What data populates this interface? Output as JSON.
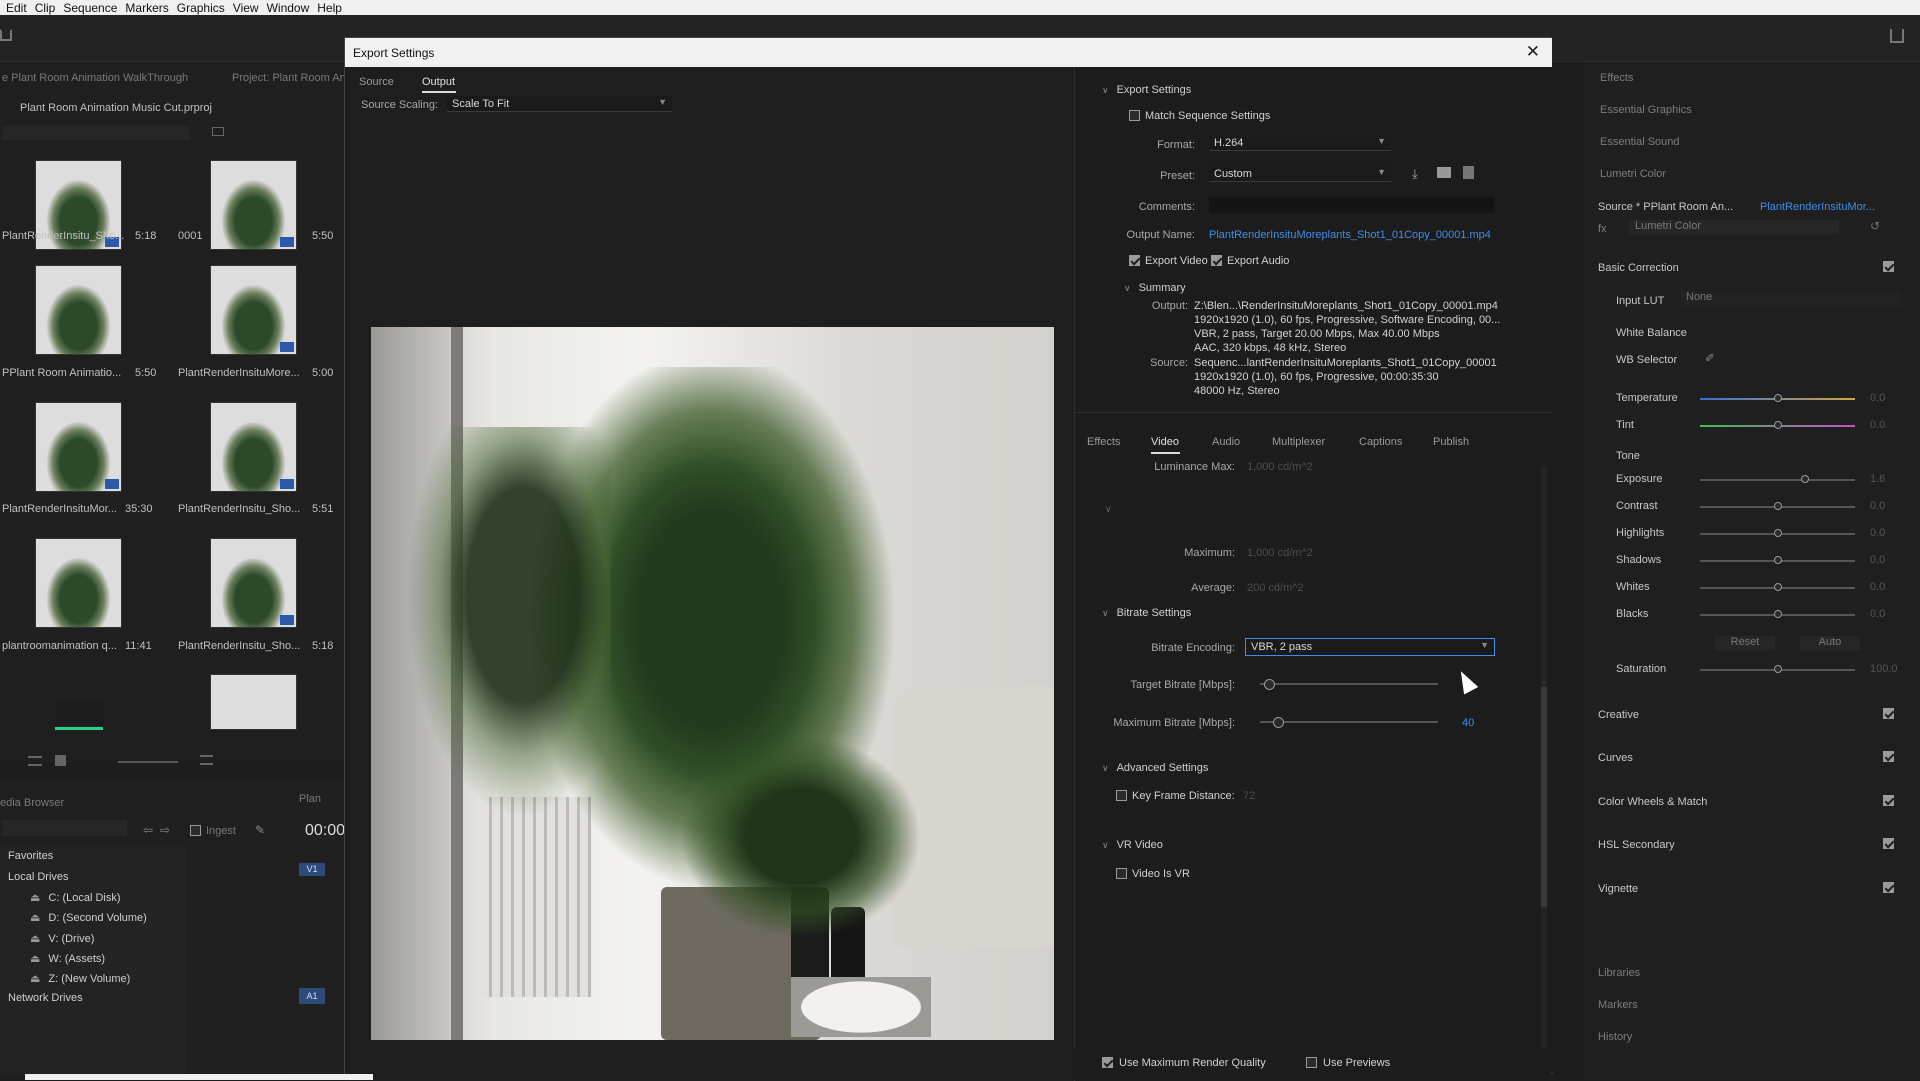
{
  "menubar": {
    "items": [
      "Edit",
      "Clip",
      "Sequence",
      "Markers",
      "Graphics",
      "View",
      "Window",
      "Help"
    ]
  },
  "project": {
    "tab_left": "e Plant Room Animation WalkThrough",
    "tab_right": "Project: Plant Room An",
    "file": "Plant Room Animation Music Cut.prproj",
    "items": [
      {
        "name": "PlantRenderInsitu_Sho...",
        "dur": "5:18"
      },
      {
        "name": "0001",
        "dur": "5:50"
      },
      {
        "name": "PPlant Room Animatio...",
        "dur": "5:50"
      },
      {
        "name": "PlantRenderInsituMore...",
        "dur": "5:00"
      },
      {
        "name": "PlantRenderInsituMor...",
        "dur": "35:30"
      },
      {
        "name": "PlantRenderInsitu_Sho...",
        "dur": "5:51"
      },
      {
        "name": "plantroomanimation q...",
        "dur": "11:41"
      },
      {
        "name": "PlantRenderInsitu_Sho...",
        "dur": "5:18"
      }
    ]
  },
  "media_browser": {
    "title": "edia Browser",
    "favorites": "Favorites",
    "local_drives": "Local Drives",
    "network_drives": "Network Drives",
    "ingest": "Ingest",
    "drives": [
      "C: (Local Disk)",
      "D: (Second Volume)",
      "V: (Drive)",
      "W: (Assets)",
      "Z: (New Volume)"
    ]
  },
  "timeline": {
    "tab": "Plan",
    "timecode": "00:00",
    "v1": "V1",
    "a1": "A1"
  },
  "lumetri": {
    "effects": "Effects",
    "essential_graphics": "Essential Graphics",
    "essential_sound": "Essential Sound",
    "lumetri_color": "Lumetri Color",
    "source": "Source * PPlant Room An...",
    "target": "PlantRenderInsituMor...",
    "fx": "fx",
    "fx_name": "Lumetri Color",
    "basic_correction": "Basic Correction",
    "input_lut": "Input LUT",
    "input_lut_val": "None",
    "white_balance": "White Balance",
    "wb_selector": "WB Selector",
    "sliders": [
      {
        "label": "Temperature",
        "value": "0.0",
        "pos": 0.5
      },
      {
        "label": "Tint",
        "value": "0.0",
        "pos": 0.5
      },
      {
        "label": "Exposure",
        "value": "1.6",
        "pos": 0.68
      },
      {
        "label": "Contrast",
        "value": "0.0",
        "pos": 0.5
      },
      {
        "label": "Highlights",
        "value": "0.0",
        "pos": 0.5
      },
      {
        "label": "Shadows",
        "value": "0.0",
        "pos": 0.5
      },
      {
        "label": "Whites",
        "value": "0.0",
        "pos": 0.5
      },
      {
        "label": "Blacks",
        "value": "0.0",
        "pos": 0.5
      },
      {
        "label": "Saturation",
        "value": "100.0",
        "pos": 0.5
      }
    ],
    "tone": "Tone",
    "reset": "Reset",
    "auto": "Auto",
    "sections": [
      "Creative",
      "Curves",
      "Color Wheels & Match",
      "HSL Secondary",
      "Vignette"
    ],
    "bottom": [
      "Libraries",
      "Markers",
      "History"
    ]
  },
  "dialog": {
    "title": "Export Settings",
    "tabs": [
      "Source",
      "Output"
    ],
    "source_scaling_label": "Source Scaling:",
    "source_scaling": "Scale To Fit",
    "export_settings": "Export Settings",
    "match_seq": "Match Sequence Settings",
    "format_label": "Format:",
    "format": "H.264",
    "preset_label": "Preset:",
    "preset": "Custom",
    "comments_label": "Comments:",
    "output_name_label": "Output Name:",
    "output_name": "PlantRenderInsituMoreplants_Shot1_01Copy_00001.mp4",
    "export_video": "Export Video",
    "export_audio": "Export Audio",
    "summary": "Summary",
    "output_label": "Output:",
    "output_lines": [
      "Z:\\Blen...\\RenderInsituMoreplants_Shot1_01Copy_00001.mp4",
      "1920x1920 (1.0), 60 fps, Progressive, Software Encoding, 00...",
      "VBR, 2 pass, Target 20.00 Mbps, Max 40.00 Mbps",
      "AAC, 320 kbps, 48 kHz, Stereo"
    ],
    "source_label": "Source:",
    "source_lines": [
      "Sequenc...lantRenderInsituMoreplants_Shot1_01Copy_00001",
      "1920x1920 (1.0), 60 fps, Progressive, 00:00:35:30",
      "48000 Hz, Stereo"
    ],
    "settings_tabs": [
      "Effects",
      "Video",
      "Audio",
      "Multiplexer",
      "Captions",
      "Publish"
    ],
    "lum_max_label": "Luminance Max:",
    "lum_max": "1,000 cd/m^2",
    "maximum_label": "Maximum:",
    "maximum": "1,000 cd/m^2",
    "average_label": "Average:",
    "average": "200 cd/m^2",
    "bitrate_settings": "Bitrate Settings",
    "bitrate_enc_label": "Bitrate Encoding:",
    "bitrate_enc": "VBR, 2 pass",
    "target_label": "Target Bitrate [Mbps]:",
    "target_pos": 0.05,
    "max_label": "Maximum Bitrate [Mbps]:",
    "max_value": "40",
    "max_pos": 0.1,
    "advanced": "Advanced Settings",
    "keyframe": "Key Frame Distance:",
    "keyframe_val": "72",
    "vr_video": "VR Video",
    "video_is_vr": "Video Is VR",
    "max_render": "Use Maximum Render Quality",
    "use_previews": "Use Previews"
  },
  "colors": {
    "accent": "#3f8ee6",
    "checkbox": "#9a9a9a"
  }
}
